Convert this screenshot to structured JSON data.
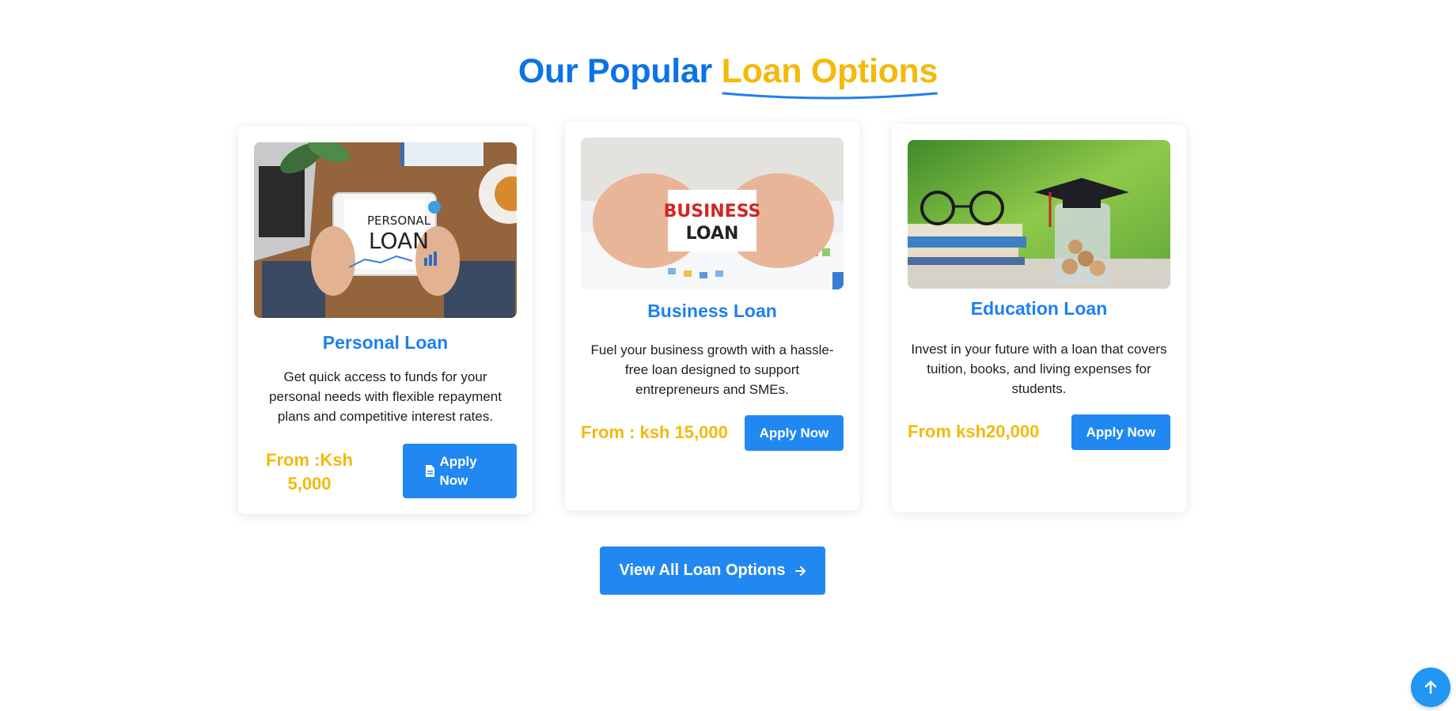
{
  "section": {
    "heading_part1": "Our Popular ",
    "heading_part2": "Loan Options"
  },
  "cards": [
    {
      "title": "Personal Loan",
      "image_text_top": "PERSONAL",
      "image_text_bottom": "LOAN",
      "description": "Get quick access to funds for your personal needs with flexible repayment plans and competitive interest rates.",
      "price": "From :Ksh 5,000",
      "button": "Apply Now",
      "button_icon": "document-icon"
    },
    {
      "title": "Business Loan",
      "image_text_top": "BUSINESS",
      "image_text_bottom": "LOAN",
      "description": "Fuel your business growth with a hassle-free loan designed to support entrepreneurs and SMEs.",
      "price": "From : ksh 15,000",
      "button": "Apply Now"
    },
    {
      "title": "Education Loan",
      "description": "Invest in your future with a loan that covers tuition, books, and living expenses for students.",
      "price": "From ksh20,000",
      "button": "Apply Now"
    }
  ],
  "view_all": {
    "label": "View All Loan Options",
    "icon": "arrow-right-icon"
  },
  "scroll_top": {
    "icon": "arrow-up-icon"
  },
  "colors": {
    "primary": "#0b73e8",
    "accent": "#f3b90c",
    "button": "#2188f2"
  }
}
